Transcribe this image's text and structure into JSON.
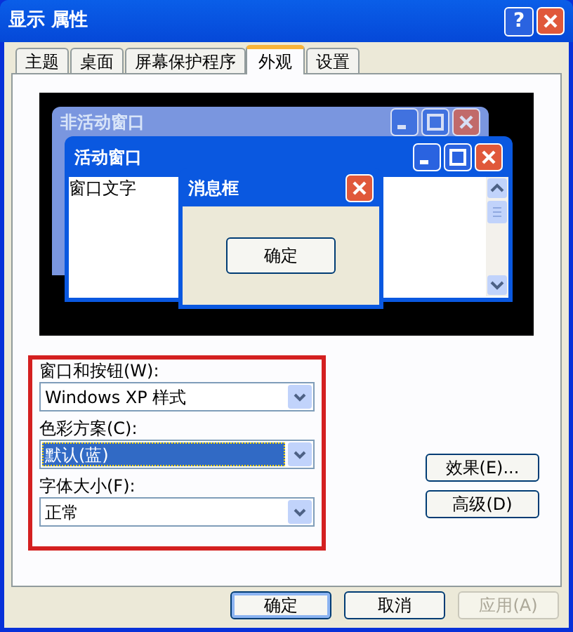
{
  "window": {
    "title": "显示 属性",
    "help": "?"
  },
  "tabs": [
    {
      "label": "主题",
      "selected": false
    },
    {
      "label": "桌面",
      "selected": false
    },
    {
      "label": "屏幕保护程序",
      "selected": false
    },
    {
      "label": "外观",
      "selected": true
    },
    {
      "label": "设置",
      "selected": false
    }
  ],
  "preview": {
    "inactive_title": "非活动窗口",
    "active_title": "活动窗口",
    "window_text": "窗口文字",
    "message_title": "消息框",
    "message_button": "确定"
  },
  "settings": [
    {
      "label": "窗口和按钮(W):",
      "value": "Windows XP 样式",
      "focused": false
    },
    {
      "label": "色彩方案(C):",
      "value": "默认(蓝)",
      "focused": true
    },
    {
      "label": "字体大小(F):",
      "value": "正常",
      "focused": false
    }
  ],
  "side_buttons": [
    "效果(E)...",
    "高级(D)"
  ],
  "footer_buttons": [
    {
      "label": "确定",
      "default": true,
      "disabled": false
    },
    {
      "label": "取消",
      "default": false,
      "disabled": false
    },
    {
      "label": "应用(A)",
      "default": false,
      "disabled": true
    }
  ]
}
